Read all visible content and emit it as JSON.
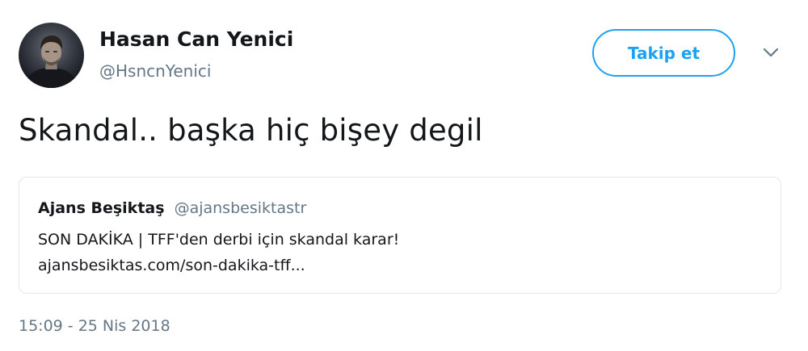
{
  "author": {
    "name": "Hasan Can Yenici",
    "handle": "@HsncnYenici",
    "avatar_icon": "profile-photo"
  },
  "actions": {
    "follow_label": "Takip et",
    "menu_icon": "chevron-down-icon"
  },
  "tweet": {
    "text": "Skandal.. başka hiç bişey degil",
    "timestamp": "15:09 - 25 Nis 2018"
  },
  "quoted_tweet": {
    "name": "Ajans Beşiktaş",
    "handle": "@ajansbesiktastr",
    "text": "SON DAKİKA | TFF'den derbi için skandal karar!",
    "link": "ajansbesiktas.com/son-dakika-tff..."
  },
  "colors": {
    "accent": "#1da1f2",
    "text": "#14171a",
    "secondary_text": "#657786",
    "border": "#e1e8ed"
  }
}
